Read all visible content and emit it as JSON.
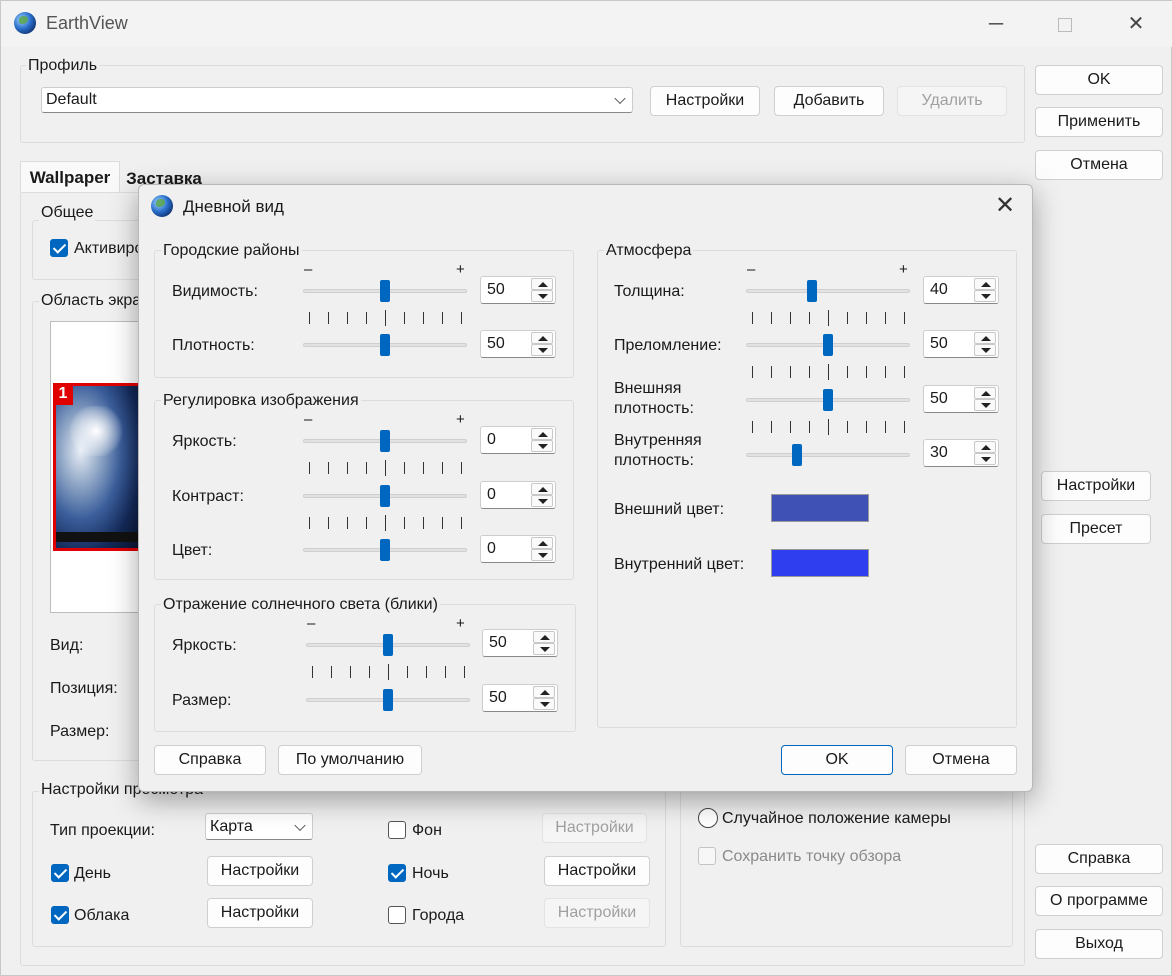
{
  "app": {
    "title": "EarthView"
  },
  "profile": {
    "label": "Профиль",
    "selected": "Default",
    "settings_btn": "Настройки",
    "add_btn": "Добавить",
    "delete_btn": "Удалить"
  },
  "right_buttons": {
    "ok": "OK",
    "apply": "Применить",
    "cancel": "Отмена",
    "settings": "Настройки",
    "preset": "Пресет",
    "help": "Справка",
    "about": "О программе",
    "exit": "Выход"
  },
  "tabs": [
    {
      "label": "Wallpaper"
    },
    {
      "label": "Заставка"
    }
  ],
  "general": {
    "label": "Общее",
    "activate": "Активиро"
  },
  "screen_area": {
    "label": "Область экра",
    "badge": "1",
    "view": "Вид:",
    "position": "Позиция:",
    "size": "Размер:"
  },
  "view_settings": {
    "label": "Настройки просмотра",
    "projection_label": "Тип проекции:",
    "projection_value": "Карта",
    "day": "День",
    "clouds": "Облака",
    "background": "Фон",
    "night": "Ночь",
    "cities": "Города",
    "settings": "Настройки"
  },
  "camera": {
    "random": "Случайное положение камеры",
    "save_view": "Сохранить точку обзора"
  },
  "dialog": {
    "title": "Дневной вид",
    "minus": "–",
    "plus": "+",
    "city": {
      "label": "Городские районы",
      "visibility": "Видимость:",
      "visibility_val": "50",
      "visibility_level": 0.5,
      "density": "Плотность:",
      "density_val": "50",
      "density_level": 0.5
    },
    "image": {
      "label": "Регулировка изображения",
      "brightness": "Яркость:",
      "brightness_val": "0",
      "contrast": "Контраст:",
      "contrast_val": "0",
      "color": "Цвет:",
      "color_val": "0"
    },
    "sun": {
      "label": "Отражение солнечного света (блики)",
      "brightness": "Яркость:",
      "brightness_val": "50",
      "size": "Размер:",
      "size_val": "50"
    },
    "atmo": {
      "label": "Атмосфера",
      "thickness": "Толщина:",
      "thickness_val": "40",
      "refraction": "Преломление:",
      "refraction_val": "50",
      "outer_density_1": "Внешняя",
      "outer_density_2": "плотность:",
      "outer_density_val": "50",
      "inner_density_1": "Внутренняя",
      "inner_density_2": "плотность:",
      "inner_density_val": "30",
      "outer_color": "Внешний цвет:",
      "outer_color_hex": "#3f51b5",
      "inner_color": "Внутренний цвет:",
      "inner_color_hex": "#2f3ff0"
    },
    "help": "Справка",
    "defaults": "По умолчанию",
    "ok": "OK",
    "cancel": "Отмена"
  }
}
